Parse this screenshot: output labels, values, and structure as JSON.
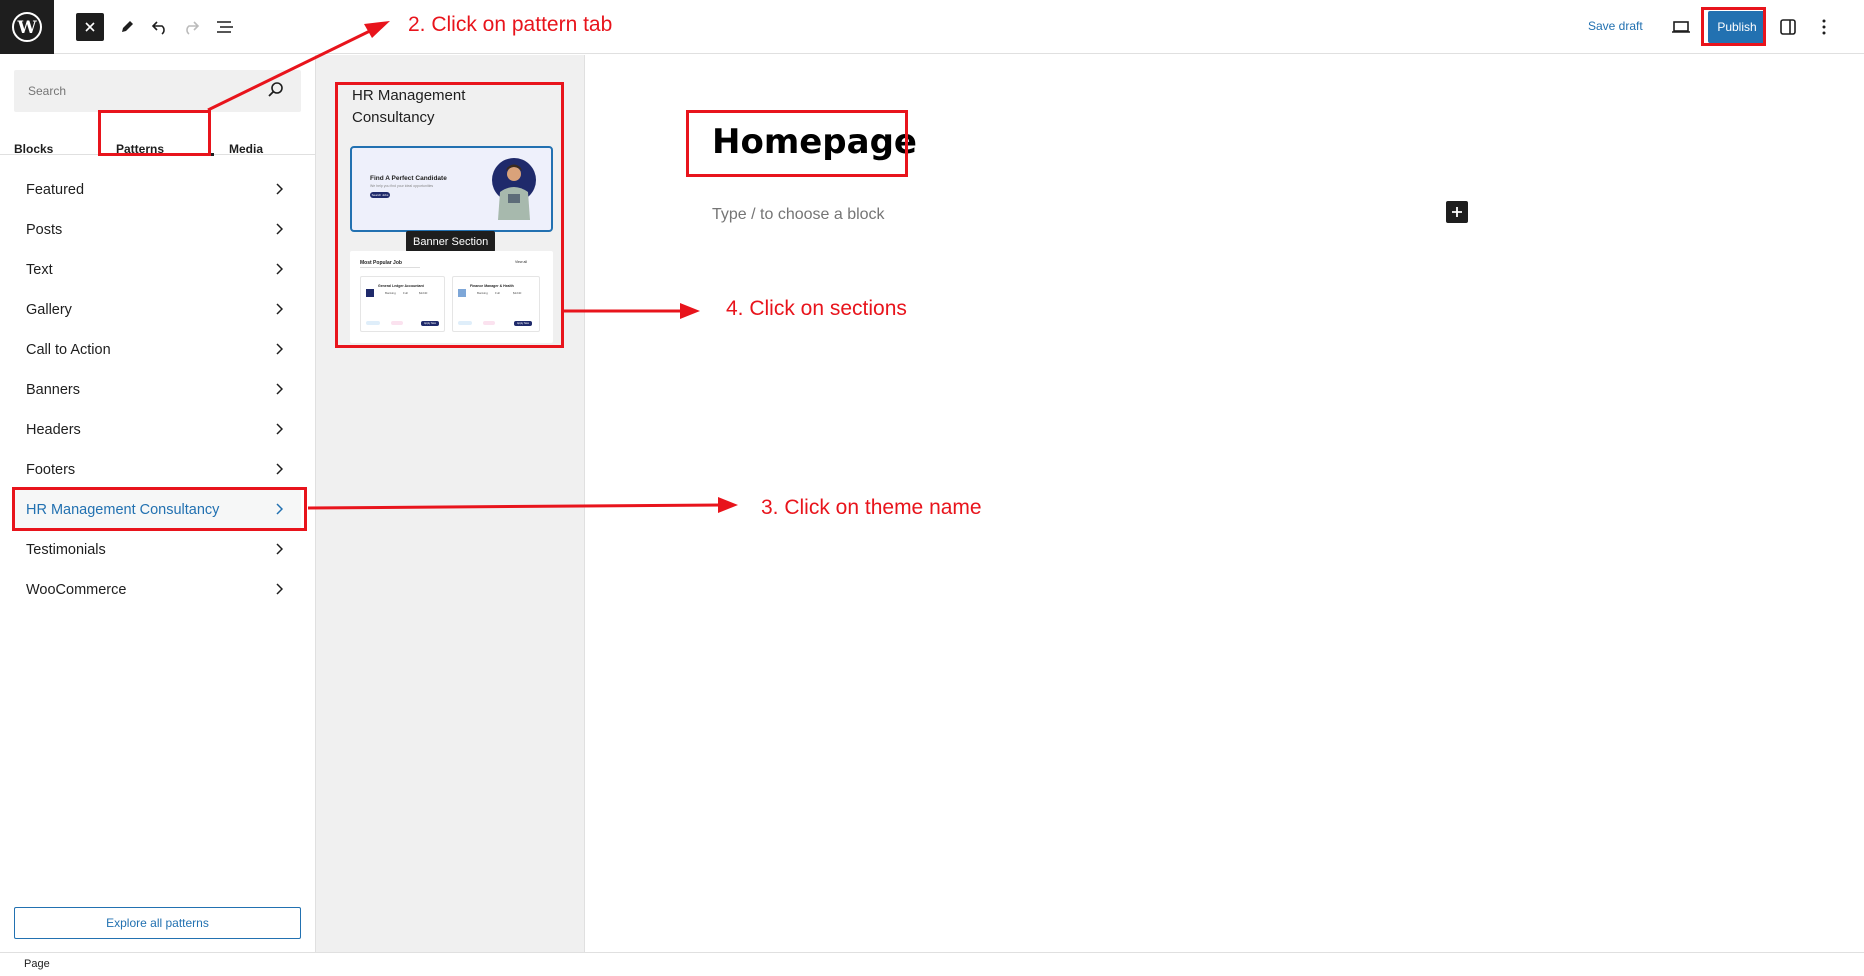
{
  "topbar": {
    "save_draft": "Save draft",
    "publish": "Publish",
    "icons": [
      "wordpress-logo-icon",
      "close-icon",
      "pencil-icon",
      "undo-icon",
      "redo-icon",
      "list-view-icon",
      "desktop-preview-icon",
      "sidebar-toggle-icon",
      "more-options-icon"
    ]
  },
  "sidebar": {
    "search_placeholder": "Search",
    "tabs": [
      {
        "label": "Blocks"
      },
      {
        "label": "Patterns",
        "selected": true
      },
      {
        "label": "Media"
      }
    ],
    "categories": [
      {
        "label": "Featured"
      },
      {
        "label": "Posts"
      },
      {
        "label": "Text"
      },
      {
        "label": "Gallery"
      },
      {
        "label": "Call to Action"
      },
      {
        "label": "Banners"
      },
      {
        "label": "Headers"
      },
      {
        "label": "Footers"
      },
      {
        "label": "HR Management Consultancy",
        "active": true
      },
      {
        "label": "Testimonials"
      },
      {
        "label": "WooCommerce"
      }
    ],
    "explore_button": "Explore all patterns"
  },
  "pattern_panel": {
    "title": "HR Management Consultancy",
    "tooltip": "Banner Section",
    "card1": {
      "heading": "Find A Perfect Candidate",
      "subtext": "We help you find your ideal opportunities",
      "button": "Search Jobs"
    },
    "card2": {
      "heading": "Most Popular Job",
      "link": "View all",
      "jobs": [
        {
          "title": "General Ledger Accountant",
          "meta": [
            "Banking",
            "Full",
            "$2240"
          ],
          "button": "Apply Now"
        },
        {
          "title": "Finance Manager & Health",
          "meta": [
            "Banking",
            "Full",
            "$2240"
          ],
          "button": "Apply Now"
        }
      ]
    }
  },
  "canvas": {
    "page_title": "Homepage",
    "block_placeholder": "Type / to choose a block"
  },
  "footer": {
    "breadcrumb": "Page"
  },
  "annotations": {
    "step2": "2. Click on pattern tab",
    "step3": "3.  Click on theme name",
    "step4": "4. Click on sections"
  },
  "colors": {
    "accent": "#2271b1",
    "annotation_red": "#e8141c",
    "dark": "#1e1e1e"
  }
}
